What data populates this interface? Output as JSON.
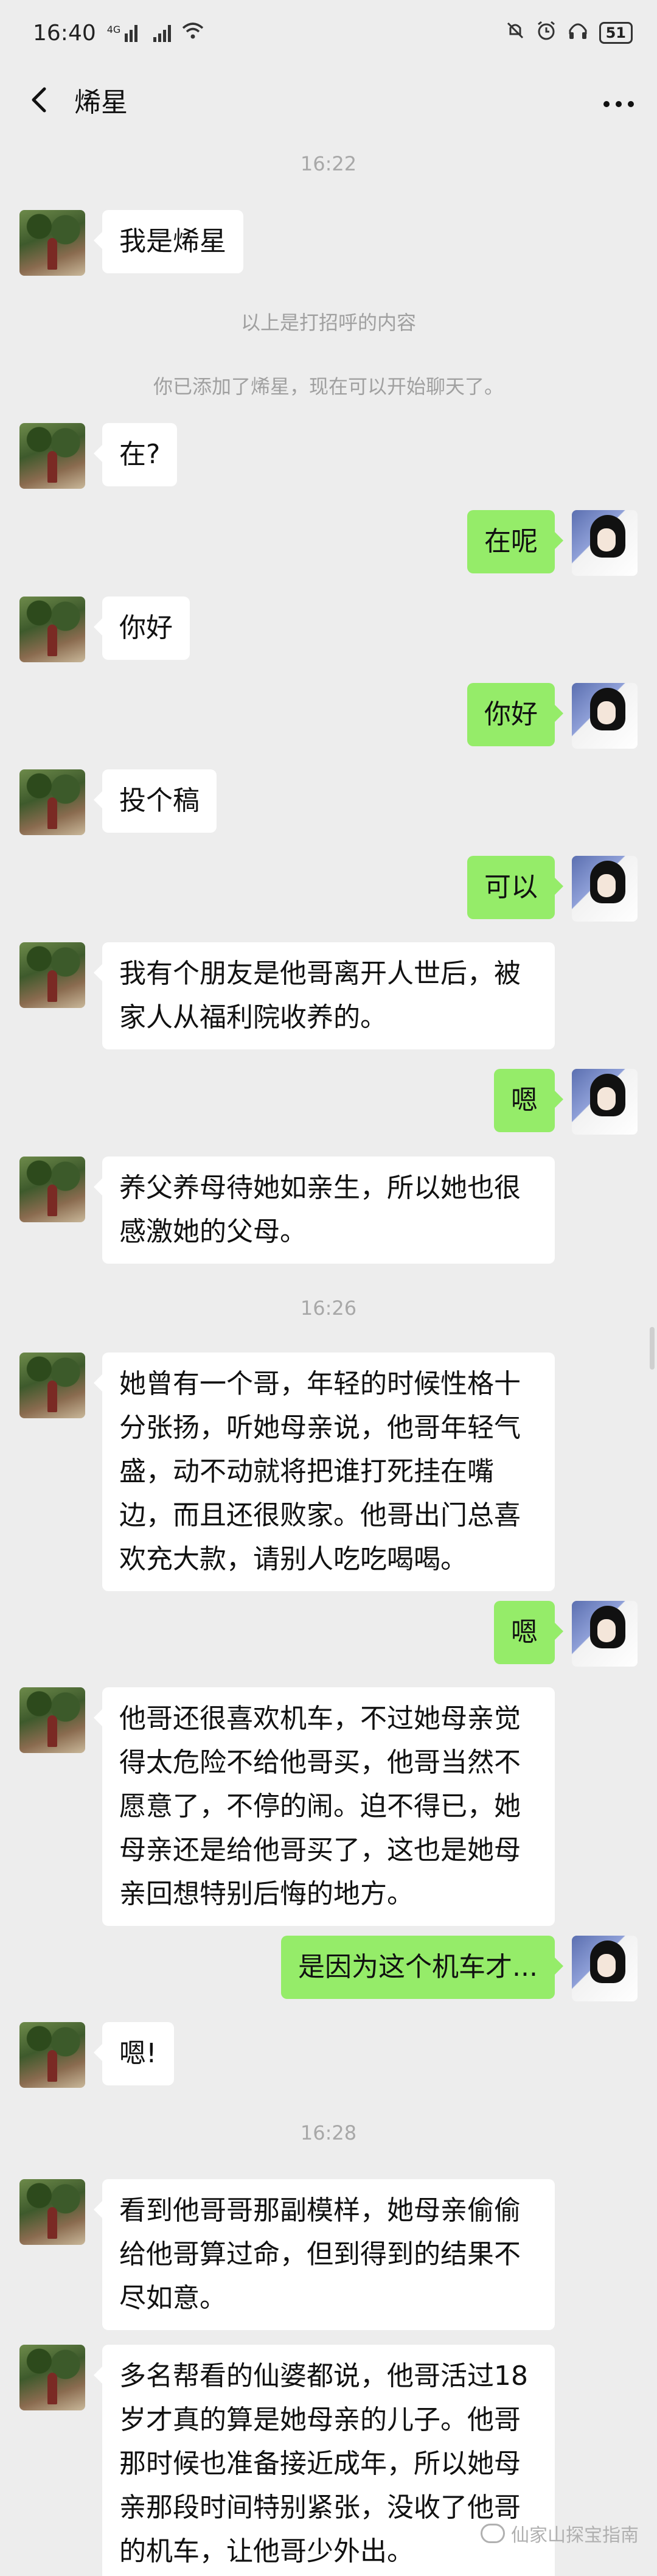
{
  "status_bar": {
    "time": "16:40",
    "signal_label": "4G",
    "battery": "51"
  },
  "header": {
    "title": "烯星"
  },
  "timestamps": [
    "16:22",
    "16:26",
    "16:28"
  ],
  "system_notices": [
    "以上是打招呼的内容",
    "你已添加了烯星，现在可以开始聊天了。"
  ],
  "messages": [
    {
      "side": "in",
      "text": "我是烯星"
    },
    {
      "side": "in",
      "text": "在?"
    },
    {
      "side": "out",
      "text": "在呢"
    },
    {
      "side": "in",
      "text": "你好"
    },
    {
      "side": "out",
      "text": "你好"
    },
    {
      "side": "in",
      "text": "投个稿"
    },
    {
      "side": "out",
      "text": "可以"
    },
    {
      "side": "in",
      "text": "我有个朋友是他哥离开人世后，被家人从福利院收养的。"
    },
    {
      "side": "out",
      "text": "嗯"
    },
    {
      "side": "in",
      "text": "养父养母待她如亲生，所以她也很感激她的父母。"
    },
    {
      "side": "in",
      "text": "她曾有一个哥，年轻的时候性格十分张扬，听她母亲说，他哥年轻气盛，动不动就将把谁打死挂在嘴边，而且还很败家。他哥出门总喜欢充大款，请别人吃吃喝喝。"
    },
    {
      "side": "out",
      "text": "嗯"
    },
    {
      "side": "in",
      "text": "他哥还很喜欢机车，不过她母亲觉得太危险不给他哥买，他哥当然不愿意了，不停的闹。迫不得已，她母亲还是给他哥买了，这也是她母亲回想特别后悔的地方。"
    },
    {
      "side": "out",
      "text": "是因为这个机车才..."
    },
    {
      "side": "in",
      "text": "嗯!"
    },
    {
      "side": "in",
      "text": "看到他哥哥那副模样，她母亲偷偷给他哥算过命，但到得到的结果不尽如意。"
    },
    {
      "side": "in",
      "text": "多名帮看的仙婆都说，他哥活过18岁才真的算是她母亲的儿子。他哥那时候也准备接近成年，所以她母亲那段时间特别紧张，没收了他哥的机车，让他哥少外出。"
    }
  ],
  "watermark": "仙家山探宝指南"
}
